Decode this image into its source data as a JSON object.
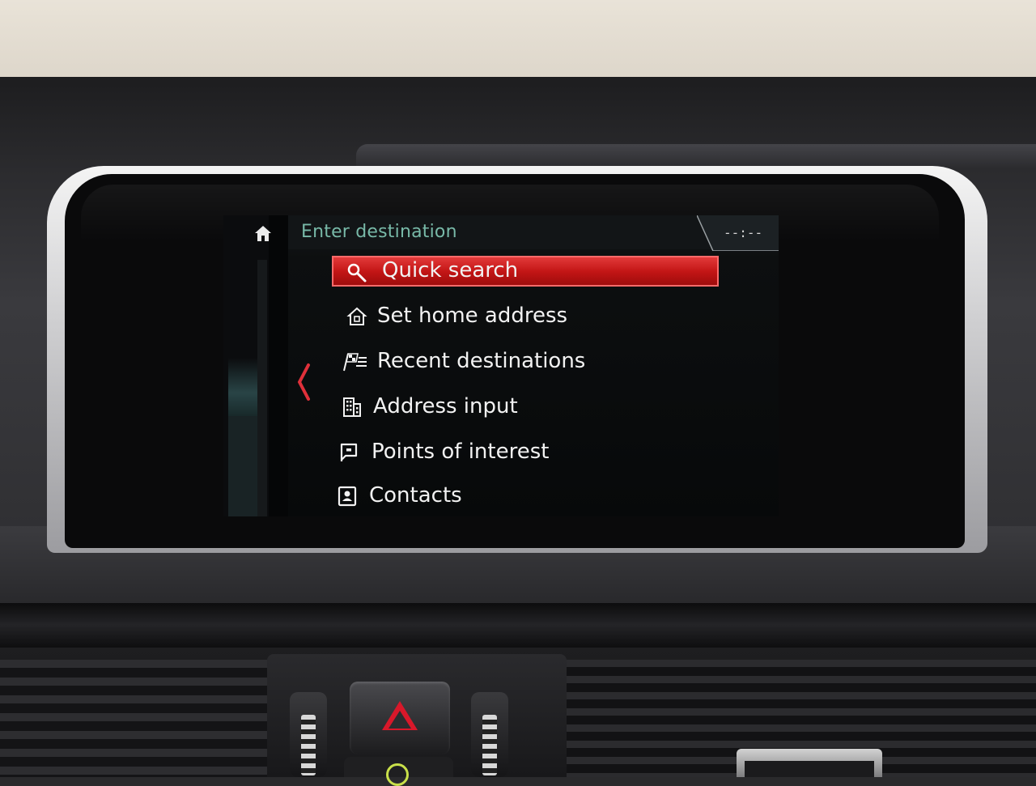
{
  "screen": {
    "header": {
      "title": "Enter destination",
      "clock": "--:--"
    },
    "menu": [
      {
        "label": "Quick search",
        "icon": "search-icon",
        "selected": true
      },
      {
        "label": "Set home address",
        "icon": "home-address-icon",
        "selected": false
      },
      {
        "label": "Recent destinations",
        "icon": "checkered-flag-icon",
        "selected": false
      },
      {
        "label": "Address input",
        "icon": "building-icon",
        "selected": false
      },
      {
        "label": "Points of interest",
        "icon": "poi-flag-icon",
        "selected": false
      },
      {
        "label": "Contacts",
        "icon": "contact-card-icon",
        "selected": false
      }
    ]
  },
  "colors": {
    "accent_red": "#c41616",
    "title_teal": "#78b9a8",
    "back_arrow": "#e0303a",
    "hazard_red": "#d8182a"
  }
}
